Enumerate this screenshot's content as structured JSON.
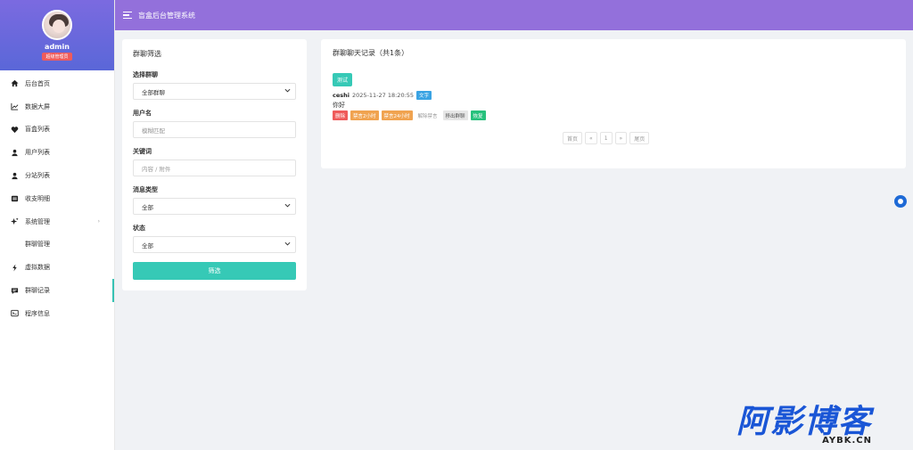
{
  "app": {
    "title": "盲盒后台管理系统"
  },
  "profile": {
    "username": "admin",
    "role": "超级管理员"
  },
  "sidebar": {
    "items": [
      {
        "label": "后台首页",
        "icon": "home-icon"
      },
      {
        "label": "数据大屏",
        "icon": "chart-icon"
      },
      {
        "label": "盲盒列表",
        "icon": "heart-icon"
      },
      {
        "label": "用户列表",
        "icon": "user-icon"
      },
      {
        "label": "分站列表",
        "icon": "user-icon"
      },
      {
        "label": "收支明细",
        "icon": "wallet-icon"
      },
      {
        "label": "系统管理",
        "icon": "sparkle-icon"
      },
      {
        "label": "群聊管理",
        "icon": ""
      },
      {
        "label": "虚拟数据",
        "icon": "bolt-icon"
      },
      {
        "label": "群聊记录",
        "icon": "chat-icon"
      },
      {
        "label": "程序信息",
        "icon": "terminal-icon"
      }
    ]
  },
  "filter": {
    "title": "群聊筛选",
    "group_label": "选择群聊",
    "group_value": "全部群聊",
    "username_label": "用户名",
    "username_placeholder": "模糊匹配",
    "keyword_label": "关键词",
    "keyword_placeholder": "内容 / 附件",
    "msgtype_label": "消息类型",
    "msgtype_value": "全部",
    "status_label": "状态",
    "status_value": "全部",
    "submit_label": "筛选"
  },
  "records": {
    "title": "群聊聊天记录（共1条）",
    "group_tag": "测试",
    "message": {
      "sender": "ceshi",
      "time": "2025-11-27 18:20:55",
      "type": "文字",
      "content": "你好"
    },
    "actions": [
      "删除",
      "禁言2小时",
      "禁言24小时",
      "解除禁言",
      "移出群聊",
      "恢复"
    ]
  },
  "pager": {
    "first": "首页",
    "prev": "«",
    "page": "1",
    "next": "»",
    "last": "尾页"
  },
  "watermark": {
    "main": "阿影博客",
    "sub": "AYBK.CN"
  },
  "colors": {
    "topbar": "#9370db",
    "accent": "#36c9b6",
    "danger": "#ef5b5b",
    "warn": "#f0a350",
    "success": "#27c17d",
    "info": "#3aa3e3"
  }
}
